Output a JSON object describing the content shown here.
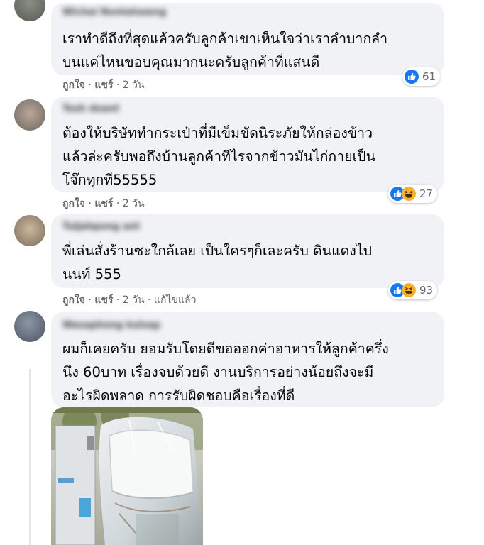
{
  "comments": [
    {
      "author": "Wichai Nontahawng",
      "lines": [
        "เราทำดีถึงที่สุดแล้วครับลูกค้าเขาเห็นใจว่าเราลำบากลำ",
        "บนแค่ไหนขอบคุณมากนะครับลูกค้าที่แสนดี"
      ],
      "actions": {
        "like": "ถูกใจ",
        "reply": "แชร์",
        "time": "2 วัน"
      },
      "reactions": {
        "types": [
          "like"
        ],
        "count": "61"
      }
    },
    {
      "author": "Tosh doant",
      "lines": [
        "ต้องให้บริษัททำกระเป๋าที่มีเข็มขัดนิระภัยให้กล่องข้าว",
        "แล้วล่ะครับพอถึงบ้านลูกค้าทีไรจากข้าวมันไก่กายเป็น",
        "โจ๊กทุกที55555"
      ],
      "actions": {
        "like": "ถูกใจ",
        "reply": "แชร์",
        "time": "2 วัน"
      },
      "reactions": {
        "types": [
          "like",
          "haha"
        ],
        "count": "27"
      }
    },
    {
      "author": "Tuljahpong ant",
      "lines": [
        "พี่เล่นสั่งร้านซะใกล้เลย เป็นใครๆก็เละครับ ดินแดงไป",
        "นนท์ 555"
      ],
      "actions": {
        "like": "ถูกใจ",
        "reply": "แชร์",
        "time": "2 วัน",
        "edited": "แก้ไขแล้ว"
      },
      "reactions": {
        "types": [
          "like",
          "haha"
        ],
        "count": "93"
      }
    },
    {
      "author": "Wasaphong kulsap",
      "lines": [
        "ผมก็เคยครับ ยอมรับโดยดีขอออกค่าอาหารให้ลูกค้าครึ่ง",
        "นึง 60บาท เรื่องจบด้วยดี งานบริการอย่างน้อยถึงจะมี",
        "อะไรผิดพลาด การรับผิดชอบคือเรื่องที่ดี"
      ]
    }
  ],
  "separator": "·",
  "colors": {
    "bubble": "#f0f2f5",
    "meta": "#65676b",
    "like_blue": "#1877f2",
    "haha_yellow": "#f7b125"
  }
}
